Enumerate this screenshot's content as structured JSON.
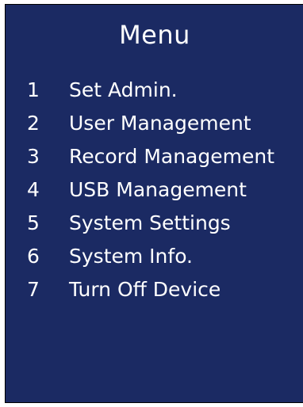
{
  "menu": {
    "title": "Menu",
    "items": [
      {
        "number": "1",
        "label": "Set Admin."
      },
      {
        "number": "2",
        "label": "User Management"
      },
      {
        "number": "3",
        "label": "Record Management"
      },
      {
        "number": "4",
        "label": "USB Management"
      },
      {
        "number": "5",
        "label": "System Settings"
      },
      {
        "number": "6",
        "label": "System Info."
      },
      {
        "number": "7",
        "label": "Turn Off Device"
      }
    ]
  },
  "colors": {
    "background": "#1b2a63",
    "text": "#ffffff"
  }
}
